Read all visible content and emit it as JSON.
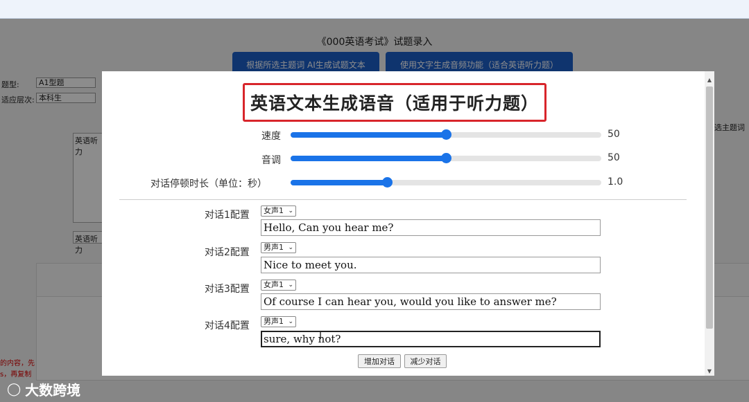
{
  "background": {
    "title": "《000英语考试》试题录入",
    "btn_ai": "根据所选主题词 AI生成试题文本",
    "btn_audio": "使用文字生成音频功能（适合英语听力题）",
    "label_type": "题型:",
    "select_type": "A1型题",
    "label_level": "适应层次:",
    "select_level": "本科生",
    "box_text": "英语听力",
    "box_text2": "英语听力",
    "right_label": "选主题词",
    "red_line1": "的内容，先",
    "red_line2": "s，再复制"
  },
  "modal": {
    "heading": "英语文本生成语音（适用于听力题）",
    "speed": {
      "label": "速度",
      "value": "50",
      "fraction": 0.5
    },
    "pitch": {
      "label": "音调",
      "value": "50",
      "fraction": 0.5
    },
    "pause": {
      "label": "对话停顿时长（单位：秒）",
      "value": "1.0",
      "fraction": 0.31
    },
    "dialogs": [
      {
        "label": "对话1配置",
        "voice": "女声1",
        "text": "Hello, Can you hear me?"
      },
      {
        "label": "对话2配置",
        "voice": "男声1",
        "text": "Nice to meet you."
      },
      {
        "label": "对话3配置",
        "voice": "女声1",
        "text": "Of course I can hear you, would you like to answer me?"
      },
      {
        "label": "对话4配置",
        "voice": "男声1",
        "text": "sure, why not?"
      }
    ],
    "add_button": "增加对话",
    "remove_button": "减少对话"
  },
  "watermark": "大数跨境",
  "colors": {
    "accent": "#1a73e8",
    "heading_border": "#d8252b",
    "bg_button": "#1d5fc9"
  }
}
